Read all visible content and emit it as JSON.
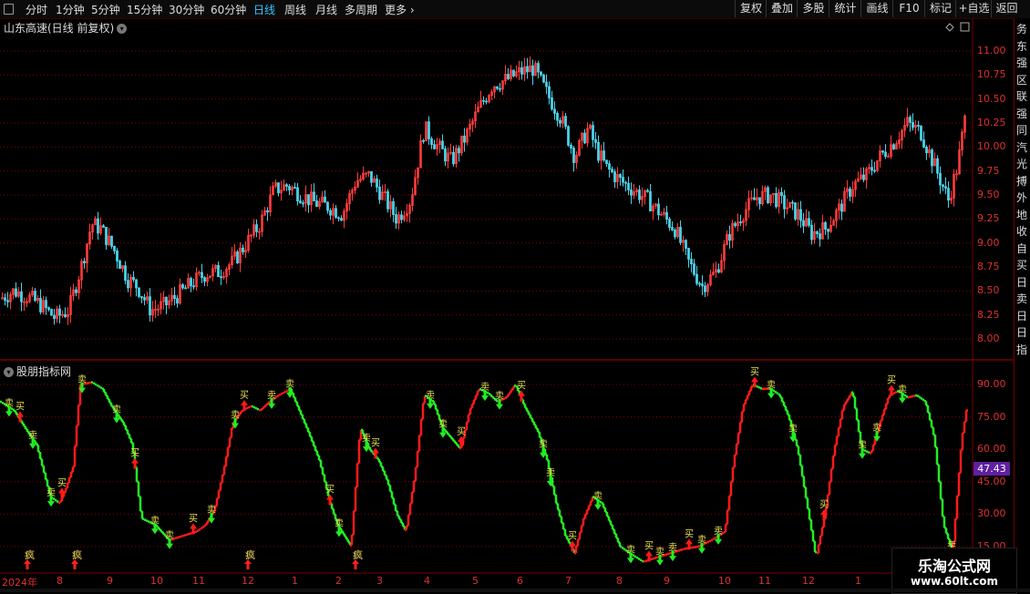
{
  "toolbar": {
    "tabs": [
      "分时",
      "1分钟",
      "5分钟",
      "15分钟",
      "30分钟",
      "60分钟",
      "日线",
      "周线",
      "月线",
      "多周期",
      "更多 ›"
    ],
    "active_tab": "日线",
    "right_buttons": [
      "复权",
      "叠加",
      "多股",
      "统计",
      "画线",
      "F10",
      "标记",
      "+自选",
      "返回"
    ]
  },
  "main_chart": {
    "title": "山东高速(日线 前复权)",
    "y_ticks": [
      "11.00",
      "10.75",
      "10.50",
      "10.25",
      "10.00",
      "9.75",
      "9.50",
      "9.25",
      "9.00",
      "8.75",
      "8.50",
      "8.25",
      "8.00"
    ],
    "colors": {
      "up": "#ff3c3c",
      "down": "#4ad2e8",
      "grid": "#8b0000"
    }
  },
  "indicator": {
    "title": "股朋指标网",
    "y_ticks": [
      "90.00",
      "75.00",
      "60.00",
      "45.00",
      "30.00",
      "15.00"
    ],
    "current_value": "47.43",
    "buy_label": "买",
    "sell_label": "卖",
    "crazy_label": "疯",
    "colors": {
      "rising": "#ff1a1a",
      "falling": "#22ee22",
      "label": "#e8e050"
    }
  },
  "x_axis": {
    "labels": [
      "2024年",
      "8",
      "9",
      "10",
      "11",
      "12",
      "1",
      "2",
      "3",
      "4",
      "5",
      "6",
      "7",
      "8",
      "9",
      "10",
      "11",
      "12",
      "1"
    ]
  },
  "right_strip": {
    "text": [
      "务",
      "东",
      "强",
      "区",
      "联",
      "强",
      "同",
      "汽",
      "光",
      "搏",
      "外",
      "地",
      "收",
      "自",
      "买",
      "日",
      "卖",
      "日",
      "日",
      "指"
    ]
  },
  "watermark": {
    "name": "乐淘公式网",
    "url": "www.60lt.com"
  },
  "chart_data": [
    {
      "type": "candlestick",
      "title": "山东高速(日线 前复权)",
      "ylim": [
        7.9,
        11.2
      ],
      "y_ticks": [
        11.0,
        10.75,
        10.5,
        10.25,
        10.0,
        9.75,
        9.5,
        9.25,
        9.0,
        8.75,
        8.5,
        8.25,
        8.0
      ],
      "x_labels": [
        "2024年",
        "8",
        "9",
        "10",
        "11",
        "12",
        "1",
        "2",
        "3",
        "4",
        "5",
        "6",
        "7",
        "8",
        "9",
        "10",
        "11",
        "12",
        "1"
      ],
      "close_path": [
        [
          0,
          8.42
        ],
        [
          15,
          8.5
        ],
        [
          30,
          8.44
        ],
        [
          45,
          8.35
        ],
        [
          60,
          8.22
        ],
        [
          75,
          8.3
        ],
        [
          90,
          8.8
        ],
        [
          100,
          9.2
        ],
        [
          110,
          9.15
        ],
        [
          125,
          8.92
        ],
        [
          140,
          8.62
        ],
        [
          150,
          8.55
        ],
        [
          165,
          8.3
        ],
        [
          180,
          8.35
        ],
        [
          195,
          8.46
        ],
        [
          210,
          8.58
        ],
        [
          225,
          8.68
        ],
        [
          240,
          8.7
        ],
        [
          255,
          8.8
        ],
        [
          270,
          9.0
        ],
        [
          285,
          9.2
        ],
        [
          300,
          9.55
        ],
        [
          315,
          9.6
        ],
        [
          330,
          9.5
        ],
        [
          345,
          9.42
        ],
        [
          360,
          9.38
        ],
        [
          375,
          9.3
        ],
        [
          390,
          9.65
        ],
        [
          405,
          9.7
        ],
        [
          420,
          9.48
        ],
        [
          435,
          9.25
        ],
        [
          450,
          9.45
        ],
        [
          465,
          10.2
        ],
        [
          480,
          10.0
        ],
        [
          495,
          9.85
        ],
        [
          510,
          10.1
        ],
        [
          525,
          10.4
        ],
        [
          540,
          10.65
        ],
        [
          555,
          10.7
        ],
        [
          570,
          10.78
        ],
        [
          585,
          10.82
        ],
        [
          600,
          10.55
        ],
        [
          615,
          10.3
        ],
        [
          630,
          9.9
        ],
        [
          645,
          10.2
        ],
        [
          655,
          9.95
        ],
        [
          665,
          9.78
        ],
        [
          680,
          9.65
        ],
        [
          695,
          9.55
        ],
        [
          710,
          9.45
        ],
        [
          725,
          9.3
        ],
        [
          740,
          9.15
        ],
        [
          755,
          8.8
        ],
        [
          770,
          8.55
        ],
        [
          785,
          8.7
        ],
        [
          800,
          9.1
        ],
        [
          815,
          9.32
        ],
        [
          830,
          9.48
        ],
        [
          845,
          9.5
        ],
        [
          860,
          9.4
        ],
        [
          875,
          9.3
        ],
        [
          890,
          9.1
        ],
        [
          905,
          9.15
        ],
        [
          920,
          9.35
        ],
        [
          935,
          9.6
        ],
        [
          950,
          9.7
        ],
        [
          965,
          9.9
        ],
        [
          980,
          10.05
        ],
        [
          995,
          10.25
        ],
        [
          1010,
          10.15
        ],
        [
          1025,
          9.8
        ],
        [
          1040,
          9.45
        ],
        [
          1050,
          9.8
        ],
        [
          1060,
          10.4
        ]
      ]
    },
    {
      "type": "line",
      "title": "股朋指标网",
      "ylim": [
        12,
        95
      ],
      "y_ticks": [
        90,
        75,
        60,
        45,
        30,
        15
      ],
      "current_value": 47.43,
      "series_path": [
        [
          0,
          82
        ],
        [
          15,
          78
        ],
        [
          30,
          68
        ],
        [
          40,
          62
        ],
        [
          55,
          38
        ],
        [
          65,
          35
        ],
        [
          72,
          42
        ],
        [
          80,
          52
        ],
        [
          88,
          90
        ],
        [
          100,
          91
        ],
        [
          112,
          88
        ],
        [
          122,
          80
        ],
        [
          135,
          72
        ],
        [
          145,
          62
        ],
        [
          155,
          28
        ],
        [
          170,
          25
        ],
        [
          185,
          18
        ],
        [
          200,
          20
        ],
        [
          215,
          22
        ],
        [
          225,
          25
        ],
        [
          235,
          32
        ],
        [
          245,
          50
        ],
        [
          255,
          72
        ],
        [
          265,
          78
        ],
        [
          275,
          80
        ],
        [
          285,
          78
        ],
        [
          295,
          82
        ],
        [
          305,
          85
        ],
        [
          318,
          88
        ],
        [
          328,
          78
        ],
        [
          338,
          68
        ],
        [
          350,
          55
        ],
        [
          362,
          35
        ],
        [
          370,
          25
        ],
        [
          385,
          15
        ],
        [
          395,
          70
        ],
        [
          405,
          60
        ],
        [
          415,
          55
        ],
        [
          425,
          45
        ],
        [
          435,
          30
        ],
        [
          445,
          22
        ],
        [
          455,
          48
        ],
        [
          465,
          85
        ],
        [
          475,
          82
        ],
        [
          485,
          70
        ],
        [
          495,
          65
        ],
        [
          505,
          60
        ],
        [
          515,
          78
        ],
        [
          525,
          88
        ],
        [
          535,
          86
        ],
        [
          545,
          82
        ],
        [
          555,
          84
        ],
        [
          565,
          90
        ],
        [
          575,
          80
        ],
        [
          590,
          68
        ],
        [
          600,
          55
        ],
        [
          610,
          35
        ],
        [
          620,
          20
        ],
        [
          630,
          12
        ],
        [
          640,
          28
        ],
        [
          650,
          38
        ],
        [
          660,
          35
        ],
        [
          670,
          25
        ],
        [
          680,
          15
        ],
        [
          690,
          12
        ],
        [
          705,
          8
        ],
        [
          720,
          10
        ],
        [
          735,
          12
        ],
        [
          750,
          14
        ],
        [
          765,
          15
        ],
        [
          780,
          18
        ],
        [
          795,
          22
        ],
        [
          805,
          55
        ],
        [
          815,
          80
        ],
        [
          825,
          90
        ],
        [
          835,
          88
        ],
        [
          845,
          88
        ],
        [
          855,
          85
        ],
        [
          865,
          75
        ],
        [
          875,
          60
        ],
        [
          885,
          35
        ],
        [
          895,
          10
        ],
        [
          905,
          30
        ],
        [
          915,
          60
        ],
        [
          925,
          80
        ],
        [
          935,
          87
        ],
        [
          945,
          60
        ],
        [
          955,
          58
        ],
        [
          965,
          72
        ],
        [
          975,
          85
        ],
        [
          985,
          87
        ],
        [
          995,
          84
        ],
        [
          1005,
          85
        ],
        [
          1015,
          82
        ],
        [
          1025,
          65
        ],
        [
          1035,
          25
        ],
        [
          1045,
          12
        ],
        [
          1055,
          65
        ],
        [
          1060,
          78
        ]
      ]
    }
  ]
}
